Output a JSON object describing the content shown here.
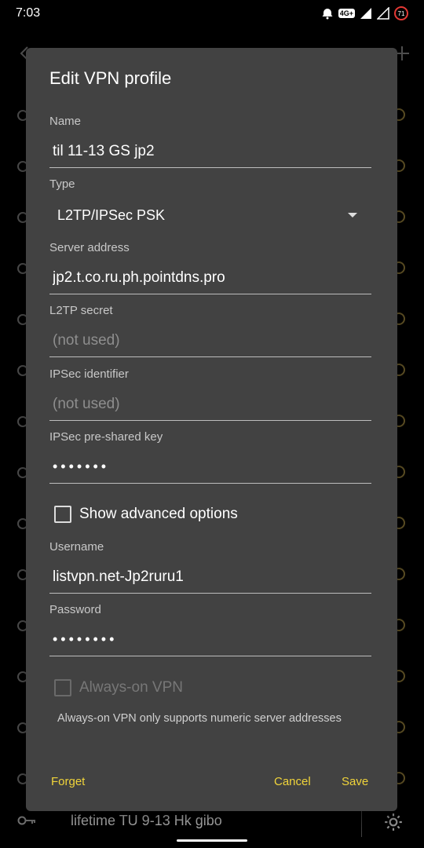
{
  "status_bar": {
    "time": "7:03",
    "network_badge": "4G+",
    "battery_level": "71",
    "icons": [
      "alarm-icon",
      "network-4g-icon",
      "signal-icon",
      "signal-icon-2",
      "battery-icon"
    ]
  },
  "background": {
    "bottom_item_label": "lifetime TU 9-13 Hk gibo"
  },
  "dialog": {
    "title": "Edit VPN profile",
    "fields": {
      "name": {
        "label": "Name",
        "value": "til 11-13 GS jp2"
      },
      "type": {
        "label": "Type",
        "value": "L2TP/IPSec PSK"
      },
      "server": {
        "label": "Server address",
        "value": "jp2.t.co.ru.ph.pointdns.pro"
      },
      "l2tp_secret": {
        "label": "L2TP secret",
        "placeholder": "(not used)"
      },
      "ipsec_identifier": {
        "label": "IPSec identifier",
        "placeholder": "(not used)"
      },
      "ipsec_psk": {
        "label": "IPSec pre-shared key",
        "value": "•••••••"
      },
      "username": {
        "label": "Username",
        "value": "listvpn.net-Jp2ruru1"
      },
      "password": {
        "label": "Password",
        "value": "••••••••"
      }
    },
    "show_advanced": "Show advanced options",
    "always_on": "Always-on VPN",
    "always_on_note": "Always-on VPN only supports numeric server addresses",
    "buttons": {
      "forget": "Forget",
      "cancel": "Cancel",
      "save": "Save"
    }
  },
  "colors": {
    "dialog_bg": "#424242",
    "accent": "#f0d43a",
    "background": "#000000"
  }
}
